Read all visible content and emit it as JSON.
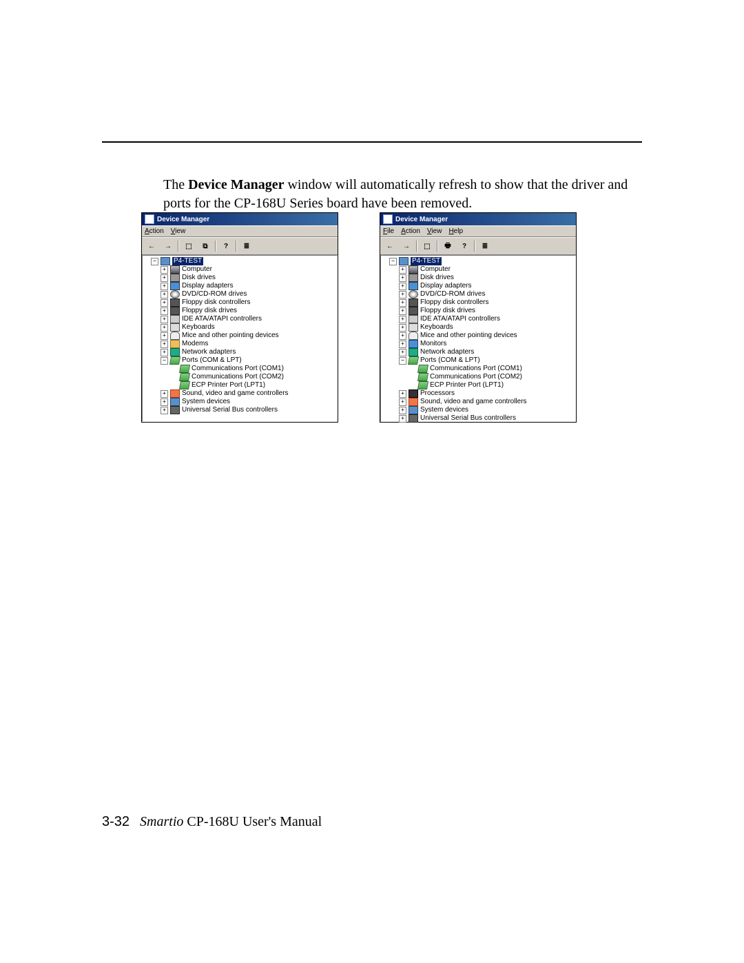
{
  "body_text_prefix": "The ",
  "body_text_bold": "Device Manager",
  "body_text_rest": " window will automatically refresh to show that the driver and ports for the CP-168U Series board have been removed.",
  "dm_left": {
    "title": "Device Manager",
    "menus": [
      "Action",
      "View"
    ],
    "toolbar": [
      "←",
      "→",
      "|",
      "⬚",
      "⧉",
      "|",
      "?",
      "|",
      "≣"
    ],
    "root": "P4-TEST",
    "items": [
      {
        "exp": "+",
        "icon": "ico-computer",
        "label": "Computer"
      },
      {
        "exp": "+",
        "icon": "ico-disk",
        "label": "Disk drives"
      },
      {
        "exp": "+",
        "icon": "ico-display",
        "label": "Display adapters"
      },
      {
        "exp": "+",
        "icon": "ico-cd",
        "label": "DVD/CD-ROM drives"
      },
      {
        "exp": "+",
        "icon": "ico-floppy",
        "label": "Floppy disk controllers"
      },
      {
        "exp": "+",
        "icon": "ico-floppy",
        "label": "Floppy disk drives"
      },
      {
        "exp": "+",
        "icon": "ico-ide",
        "label": "IDE ATA/ATAPI controllers"
      },
      {
        "exp": "+",
        "icon": "ico-keyboard",
        "label": "Keyboards"
      },
      {
        "exp": "+",
        "icon": "ico-mouse",
        "label": "Mice and other pointing devices"
      },
      {
        "exp": "+",
        "icon": "ico-modem",
        "label": "Modems"
      },
      {
        "exp": "+",
        "icon": "ico-network",
        "label": "Network adapters"
      },
      {
        "exp": "−",
        "icon": "ico-port",
        "label": "Ports (COM & LPT)"
      },
      {
        "exp": "",
        "icon": "ico-port",
        "label": "Communications Port (COM1)",
        "child": true
      },
      {
        "exp": "",
        "icon": "ico-port",
        "label": "Communications Port (COM2)",
        "child": true
      },
      {
        "exp": "",
        "icon": "ico-port",
        "label": "ECP Printer Port (LPT1)",
        "child": true
      },
      {
        "exp": "+",
        "icon": "ico-sound",
        "label": "Sound, video and game controllers"
      },
      {
        "exp": "+",
        "icon": "ico-system",
        "label": "System devices"
      },
      {
        "exp": "+",
        "icon": "ico-usb",
        "label": "Universal Serial Bus controllers"
      }
    ]
  },
  "dm_right": {
    "title": "Device Manager",
    "menus": [
      "File",
      "Action",
      "View",
      "Help"
    ],
    "toolbar": [
      "←",
      "→",
      "|",
      "⬚",
      "|",
      "🖶",
      "?",
      "|",
      "≣"
    ],
    "root": "P4-TEST",
    "items": [
      {
        "exp": "+",
        "icon": "ico-computer",
        "label": "Computer"
      },
      {
        "exp": "+",
        "icon": "ico-disk",
        "label": "Disk drives"
      },
      {
        "exp": "+",
        "icon": "ico-display",
        "label": "Display adapters"
      },
      {
        "exp": "+",
        "icon": "ico-cd",
        "label": "DVD/CD-ROM drives"
      },
      {
        "exp": "+",
        "icon": "ico-floppy",
        "label": "Floppy disk controllers"
      },
      {
        "exp": "+",
        "icon": "ico-floppy",
        "label": "Floppy disk drives"
      },
      {
        "exp": "+",
        "icon": "ico-ide",
        "label": "IDE ATA/ATAPI controllers"
      },
      {
        "exp": "+",
        "icon": "ico-keyboard",
        "label": "Keyboards"
      },
      {
        "exp": "+",
        "icon": "ico-mouse",
        "label": "Mice and other pointing devices"
      },
      {
        "exp": "+",
        "icon": "ico-monitor",
        "label": "Monitors"
      },
      {
        "exp": "+",
        "icon": "ico-network",
        "label": "Network adapters"
      },
      {
        "exp": "−",
        "icon": "ico-port",
        "label": "Ports (COM & LPT)"
      },
      {
        "exp": "",
        "icon": "ico-port",
        "label": "Communications Port (COM1)",
        "child": true
      },
      {
        "exp": "",
        "icon": "ico-port",
        "label": "Communications Port (COM2)",
        "child": true
      },
      {
        "exp": "",
        "icon": "ico-port",
        "label": "ECP Printer Port (LPT1)",
        "child": true
      },
      {
        "exp": "+",
        "icon": "ico-proc",
        "label": "Processors"
      },
      {
        "exp": "+",
        "icon": "ico-sound",
        "label": "Sound, video and game controllers"
      },
      {
        "exp": "+",
        "icon": "ico-system",
        "label": "System devices"
      },
      {
        "exp": "+",
        "icon": "ico-usb",
        "label": "Universal Serial Bus controllers"
      }
    ]
  },
  "footer": {
    "pageno": "3-32",
    "brand": "Smartio",
    "rest": " CP-168U User's Manual"
  }
}
